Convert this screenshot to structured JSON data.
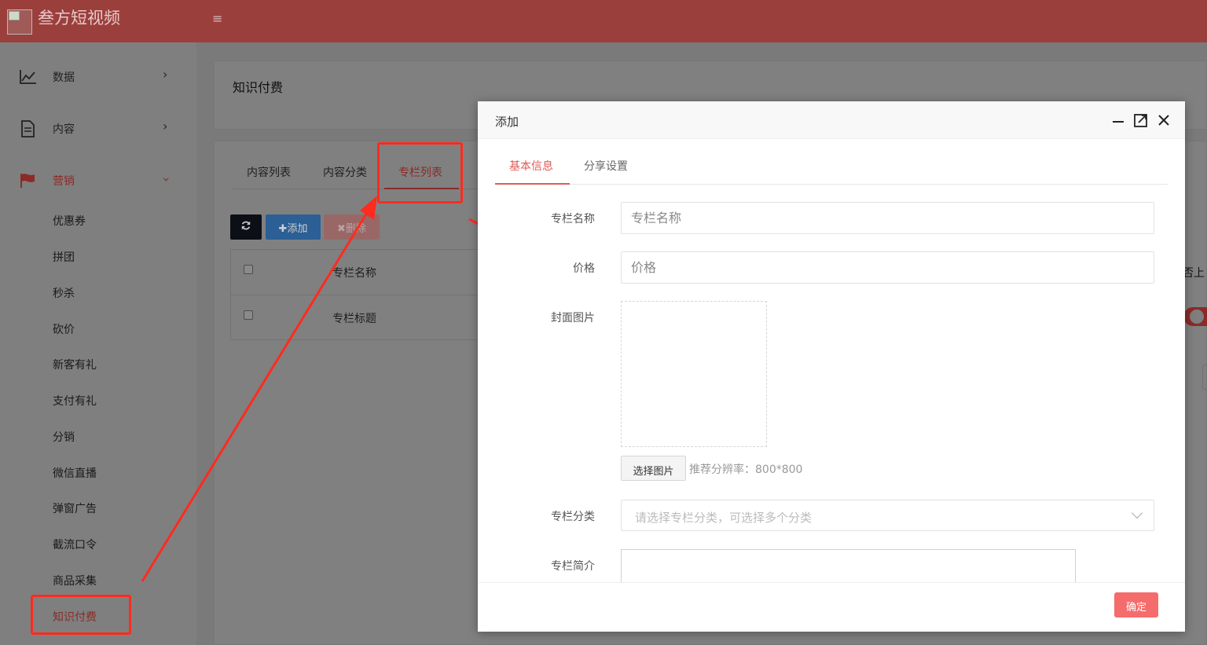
{
  "app": {
    "title": "叁方短视频",
    "menu_toggle": "≡"
  },
  "sidebar": {
    "items": [
      {
        "label": "数据",
        "icon": "chart-line-icon"
      },
      {
        "label": "内容",
        "icon": "document-icon"
      },
      {
        "label": "营销",
        "icon": "flag-icon",
        "expanded": true
      }
    ],
    "sub_items": [
      "优惠券",
      "拼团",
      "秒杀",
      "砍价",
      "新客有礼",
      "支付有礼",
      "分销",
      "微信直播",
      "弹窗广告",
      "截流口令",
      "商品采集",
      "知识付费"
    ],
    "current": "知识付费"
  },
  "page": {
    "heading": "知识付费",
    "tabs": [
      "内容列表",
      "内容分类",
      "专栏列表"
    ],
    "active_tab": "专栏列表",
    "toolbar": {
      "refresh_icon": "refresh-icon",
      "add_label": "✚添加",
      "delete_label": "✖删除"
    },
    "table": {
      "header": "专栏名称",
      "rows": [
        "专栏标题"
      ],
      "right_header_peek": "否上"
    }
  },
  "modal": {
    "title": "添加",
    "tabs": [
      "基本信息",
      "分享设置"
    ],
    "active_tab": "基本信息",
    "fields": {
      "name_label": "专栏名称",
      "name_placeholder": "专栏名称",
      "price_label": "价格",
      "price_placeholder": "价格",
      "cover_label": "封面图片",
      "choose_image": "选择图片",
      "hint": "推荐分辨率：800*800",
      "category_label": "专栏分类",
      "category_placeholder": "请选择专栏分类，可选择多个分类",
      "intro_label": "专栏简介"
    },
    "confirm_label": "确定"
  },
  "colors": {
    "header": "#9b3f3d",
    "accent": "#e05a57",
    "confirm": "#f56c6c",
    "annotation": "#ff2b1f"
  }
}
